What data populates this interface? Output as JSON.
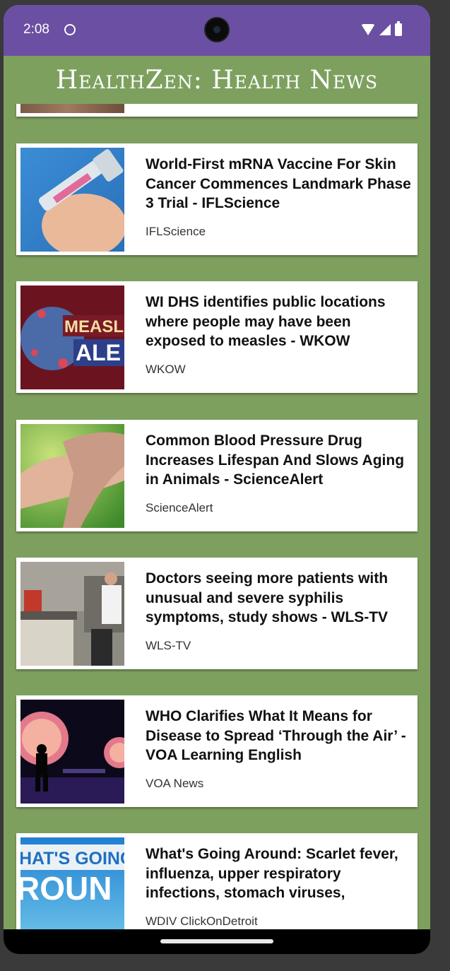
{
  "status_bar": {
    "time": "2:08"
  },
  "app_title": "HealthZen: Health News",
  "articles": [
    {
      "title": "",
      "source": ""
    },
    {
      "title": "World-First mRNA Vaccine For Skin Cancer Commences Landmark Phase 3 Trial - IFLScience",
      "source": "IFLScience"
    },
    {
      "title": "WI DHS identifies public locations where people may have been exposed to measles - WKOW",
      "source": "WKOW",
      "thumb_text": "MEASLES ALERT"
    },
    {
      "title": "Common Blood Pressure Drug Increases Lifespan And Slows Aging in Animals - ScienceAlert",
      "source": "ScienceAlert"
    },
    {
      "title": "Doctors seeing more patients with unusual and severe syphilis symptoms, study shows - WLS-TV",
      "source": "WLS-TV"
    },
    {
      "title": "WHO Clarifies What It Means for Disease to Spread ‘Through the Air’ - VOA Learning English",
      "source": "VOA News"
    },
    {
      "title": "What's Going Around: Scarlet fever, influenza, upper respiratory infections, stomach viruses,",
      "source": "WDIV ClickOnDetroit",
      "thumb_text": "WHAT'S GOING AROUND"
    }
  ]
}
